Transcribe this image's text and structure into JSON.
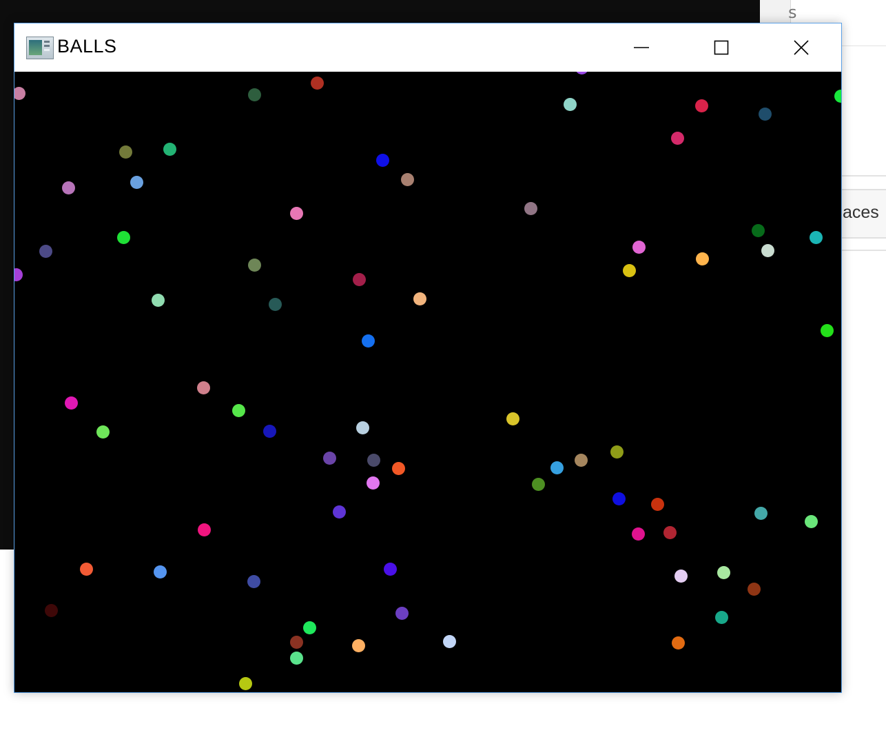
{
  "window": {
    "title": "BALLS",
    "controls": {
      "minimize": "minimize",
      "maximize": "maximize",
      "close": "close"
    },
    "icon": "app-window-icon"
  },
  "background_window": {
    "partial_char": "s",
    "partial_label": "aces"
  },
  "balls": [
    {
      "color": "#c87fa3"
    },
    {
      "color": "#2e5e3e"
    },
    {
      "color": "#b03022"
    },
    {
      "color": "#9a4ae6"
    },
    {
      "color": "#8fd4c8"
    },
    {
      "color": "#d9234a"
    },
    {
      "color": "#1f4d6b"
    },
    {
      "color": "#18e83c"
    },
    {
      "color": "#d42a6a"
    },
    {
      "color": "#737a3a"
    },
    {
      "color": "#23b374"
    },
    {
      "color": "#0f10e8"
    },
    {
      "color": "#a88070"
    },
    {
      "color": "#b774b9"
    },
    {
      "color": "#6aa1e0"
    },
    {
      "color": "#917585"
    },
    {
      "color": "#e777b5"
    },
    {
      "color": "#076b1a"
    },
    {
      "color": "#1fe036"
    },
    {
      "color": "#4c4a86"
    },
    {
      "color": "#e165d3"
    },
    {
      "color": "#1bb5b5"
    },
    {
      "color": "#c9dcd0"
    },
    {
      "color": "#ffb44c"
    },
    {
      "color": "#d9c112"
    },
    {
      "color": "#a540d8"
    },
    {
      "color": "#6e8657"
    },
    {
      "color": "#a31f4a"
    },
    {
      "color": "#90dcb0"
    },
    {
      "color": "#275a57"
    },
    {
      "color": "#f2b47d"
    },
    {
      "color": "#24e01a"
    },
    {
      "color": "#1570f0"
    },
    {
      "color": "#e118b4"
    },
    {
      "color": "#d0808c"
    },
    {
      "color": "#56e64a"
    },
    {
      "color": "#6fe65a"
    },
    {
      "color": "#1717ba"
    },
    {
      "color": "#b8d0e0"
    },
    {
      "color": "#d9c42a"
    },
    {
      "color": "#6a44a8"
    },
    {
      "color": "#4a4a6a"
    },
    {
      "color": "#f25826"
    },
    {
      "color": "#e277f0"
    },
    {
      "color": "#a5865e"
    },
    {
      "color": "#8f9c18"
    },
    {
      "color": "#36a0e0"
    },
    {
      "color": "#4d8f22"
    },
    {
      "color": "#0f0fe0"
    },
    {
      "color": "#c9320e"
    },
    {
      "color": "#5f35d6"
    },
    {
      "color": "#f0157f"
    },
    {
      "color": "#e0138f"
    },
    {
      "color": "#b02532"
    },
    {
      "color": "#44a8a8"
    },
    {
      "color": "#6ae67a"
    },
    {
      "color": "#f25b35"
    },
    {
      "color": "#5595f0"
    },
    {
      "color": "#3f4ca3"
    },
    {
      "color": "#4a10e8"
    },
    {
      "color": "#e4cdf2"
    },
    {
      "color": "#a8e8a0"
    },
    {
      "color": "#8f3514"
    },
    {
      "color": "#3e0808"
    },
    {
      "color": "#6c3fc2"
    },
    {
      "color": "#1fe85c"
    },
    {
      "color": "#8a3222"
    },
    {
      "color": "#5ae38c"
    },
    {
      "color": "#ffb062"
    },
    {
      "color": "#c2d6f7"
    },
    {
      "color": "#18a88a"
    },
    {
      "color": "#e26b12"
    },
    {
      "color": "#b6c812"
    }
  ]
}
